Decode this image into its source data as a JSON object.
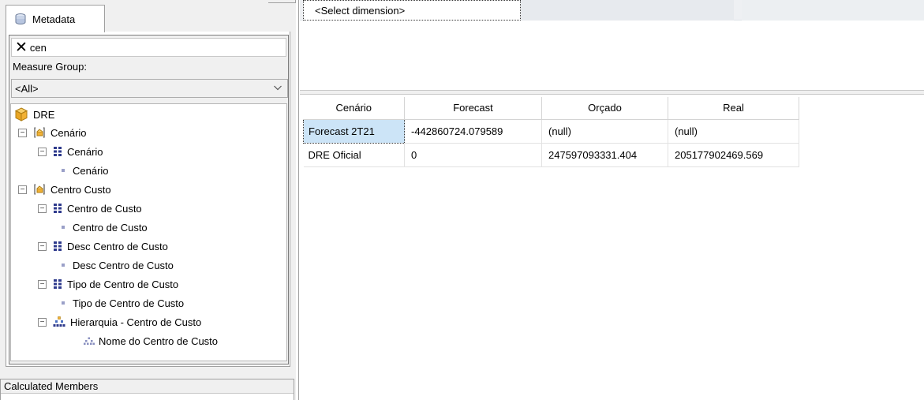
{
  "metadata_panel": {
    "tab_label": "Metadata",
    "search_value": "cen",
    "measure_group_label": "Measure Group:",
    "measure_group_value": "<All>",
    "tree": {
      "cube": "DRE",
      "dimensions": [
        {
          "label": "Cenário",
          "children": [
            {
              "type": "attribute",
              "label": "Cenário",
              "leaf": "Cenário"
            }
          ]
        },
        {
          "label": "Centro Custo",
          "children": [
            {
              "type": "attribute",
              "label": "Centro de Custo",
              "leaf": "Centro de Custo"
            },
            {
              "type": "attribute",
              "label": "Desc Centro de Custo",
              "leaf": "Desc Centro de Custo"
            },
            {
              "type": "attribute",
              "label": "Tipo de Centro de Custo",
              "leaf": "Tipo de Centro de Custo"
            },
            {
              "type": "hierarchy",
              "label": "Hierarquia - Centro de Custo",
              "leaf": "Nome do Centro de Custo"
            }
          ]
        }
      ]
    },
    "calculated_members_label": "Calculated Members"
  },
  "filter_pane": {
    "select_dimension": "<Select dimension>"
  },
  "results": {
    "headers": [
      "Cenário",
      "Forecast",
      "Orçado",
      "Real"
    ],
    "rows": [
      [
        "Forecast 2T21",
        "-442860724.079589",
        "(null)",
        "(null)"
      ],
      [
        "DRE Oficial",
        "0",
        "247597093331.404",
        "205177902469.569"
      ]
    ]
  },
  "colors": {
    "selected_cell": "#cce4f7",
    "panel_bg": "#f0f0f0",
    "attribute_icon": "#2e3a8c",
    "cube_icon": "#f2b134"
  }
}
